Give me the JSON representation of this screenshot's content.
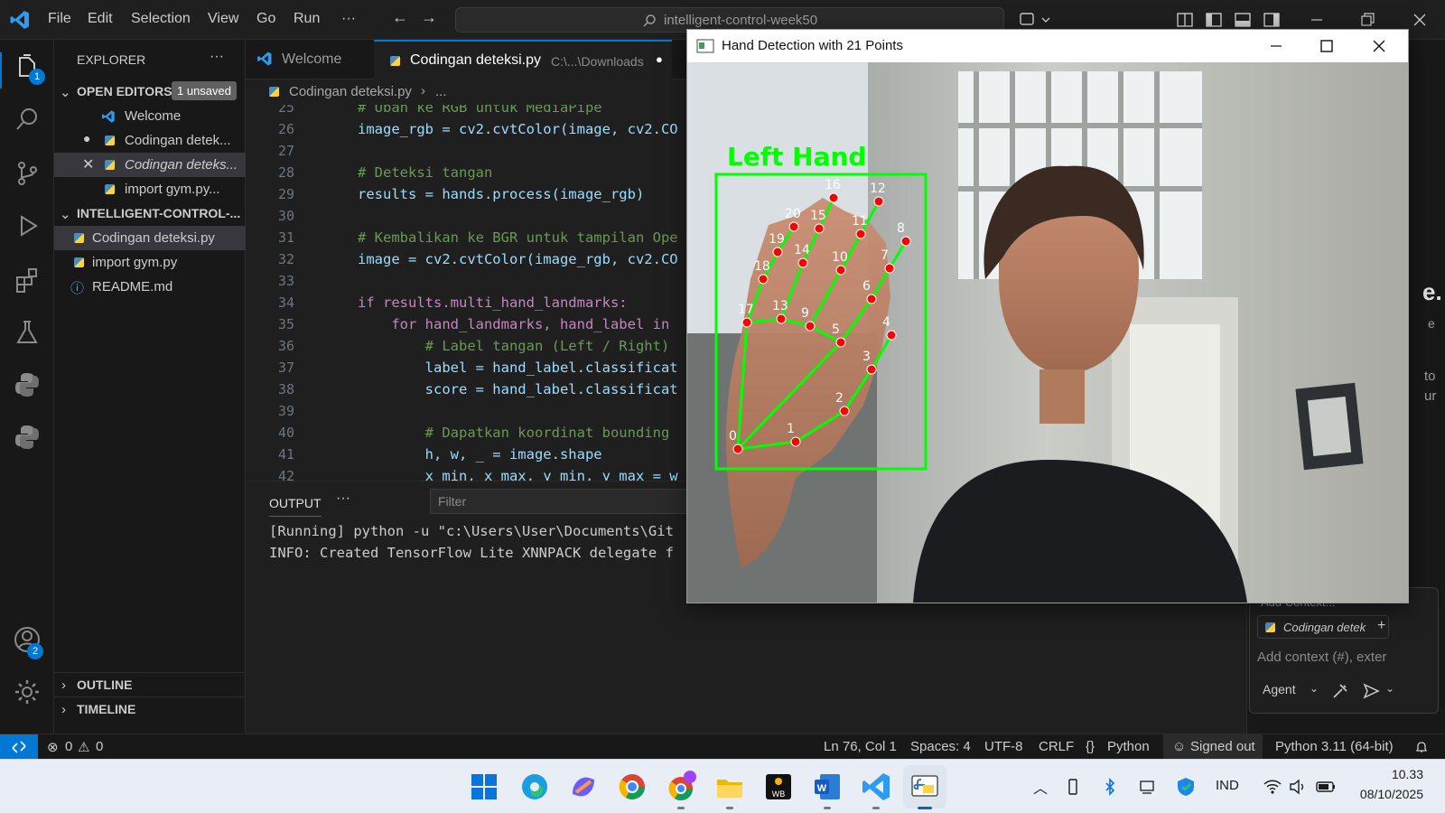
{
  "menu": [
    "File",
    "Edit",
    "Selection",
    "View",
    "Go",
    "Run",
    "···"
  ],
  "command_center": "intelligent-control-week50",
  "activity_badges": {
    "explorer": "1",
    "accounts": "2"
  },
  "explorer": {
    "title": "EXPLORER",
    "more": "···",
    "open_editors": {
      "label": "OPEN EDITORS",
      "badge": "1 unsaved"
    },
    "open_items": [
      "Welcome",
      "Codingan detek...",
      "Codingan deteks...",
      "import gym.py..."
    ],
    "folder": "INTELLIGENT-CONTROL-...",
    "files": [
      "Codingan deteksi.py",
      "import gym.py",
      "README.md"
    ],
    "outline": "OUTLINE",
    "timeline": "TIMELINE"
  },
  "tabs": [
    {
      "label": "Welcome"
    },
    {
      "label": "Codingan deteksi.py",
      "path": "C:\\...\\Downloads"
    }
  ],
  "breadcrumb": [
    "Codingan deteksi.py",
    "..."
  ],
  "code": {
    "line_numbers": [
      "25",
      "26",
      "27",
      "28",
      "29",
      "30",
      "31",
      "32",
      "33",
      "34",
      "35",
      "36",
      "37",
      "38",
      "39",
      "40",
      "41",
      "42"
    ],
    "lines": [
      "# Ubah ke RGB untuk MediaPipe",
      "image_rgb = cv2.cvtColor(image, cv2.CO",
      "",
      "# Deteksi tangan",
      "results = hands.process(image_rgb)",
      "",
      "# Kembalikan ke BGR untuk tampilan Ope",
      "image = cv2.cvtColor(image_rgb, cv2.CO",
      "",
      "if results.multi_hand_landmarks:",
      "    for hand_landmarks, hand_label in",
      "        # Label tangan (Left / Right)",
      "        label = hand_label.classificat",
      "        score = hand_label.classificat",
      "",
      "        # Dapatkan koordinat bounding",
      "        h, w, _ = image.shape",
      "        x_min, x_max, y_min, y_max = w"
    ]
  },
  "panel": {
    "tab": "OUTPUT",
    "more": "···",
    "filter_placeholder": "Filter",
    "lines": [
      "[Running] python -u \"c:\\Users\\User\\Documents\\Git",
      "INFO: Created TensorFlow Lite XNNPACK delegate f"
    ]
  },
  "chat": {
    "frag1": "e.",
    "frag2": "e",
    "frag3": "to",
    "frag4": "ur",
    "add_context": "Add Context...",
    "context_file": "Codingan detek",
    "input_placeholder": "Add context (#), exter",
    "mode": "Agent"
  },
  "cv_window": {
    "title": "Hand Detection with 21 Points",
    "hand_label": "Left Hand",
    "landmark_labels": [
      "0",
      "1",
      "2",
      "3",
      "4",
      "5",
      "6",
      "7",
      "8",
      "9",
      "10",
      "11",
      "12",
      "13",
      "14",
      "15",
      "16",
      "17",
      "18",
      "19",
      "20"
    ]
  },
  "status": {
    "errors": "0",
    "warnings": "0",
    "position": "Ln 76, Col 1",
    "spaces": "Spaces: 4",
    "encoding": "UTF-8",
    "eol": "CRLF",
    "language": "Python",
    "account": "Signed out",
    "interpreter": "Python 3.11 (64-bit)"
  },
  "tray": {
    "lang": "IND",
    "time": "10.33",
    "date": "08/10/2025"
  },
  "colors": {
    "accent": "#0078d4",
    "landmark_line": "#00ff00",
    "landmark_point": "#ff0000"
  }
}
